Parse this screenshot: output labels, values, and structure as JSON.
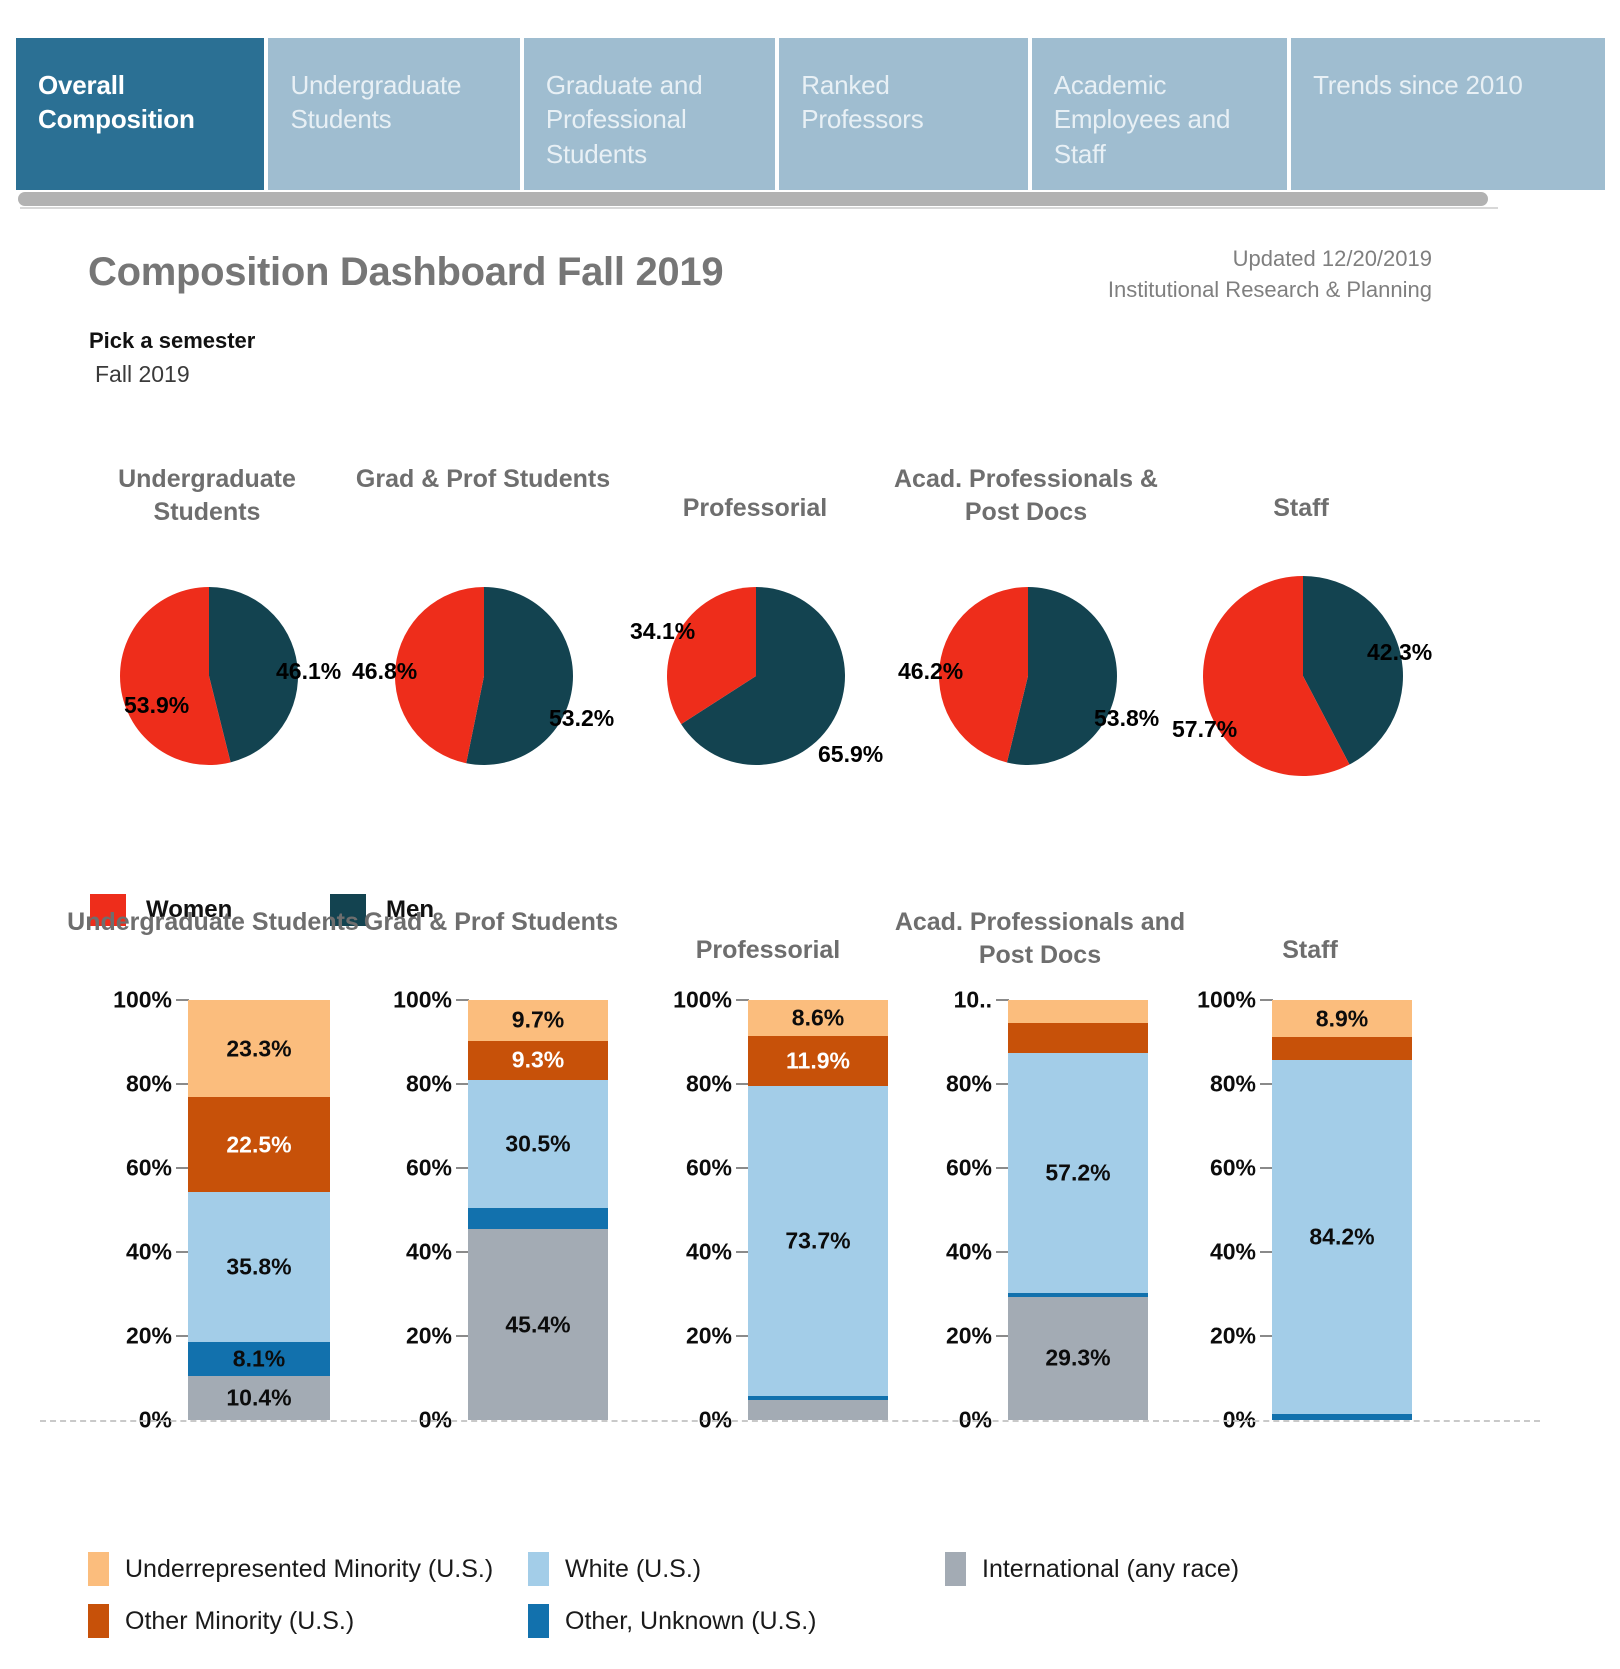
{
  "tabs": [
    {
      "label": "Overall Composition",
      "active": true
    },
    {
      "label": "Undergraduate Students",
      "active": false
    },
    {
      "label": "Graduate and Professional Students",
      "active": false
    },
    {
      "label": "Ranked Professors",
      "active": false
    },
    {
      "label": "Academic Employees and Staff",
      "active": false
    },
    {
      "label": "Trends since 2010",
      "active": false
    }
  ],
  "header": {
    "title": "Composition Dashboard  Fall 2019",
    "updated": "Updated 12/20/2019",
    "org": "Institutional Research & Planning",
    "pick_label": "Pick a semester",
    "pick_value": "Fall 2019"
  },
  "colors": {
    "tab_active_bg": "#2b7094",
    "tab_inactive_bg": "#9fbdd0",
    "women": "#ee2d1b",
    "men": "#134350",
    "underrep_minority": "#fbbd7d",
    "other_minority": "#c75109",
    "white": "#a3cde8",
    "other_unknown": "#1271ad",
    "international": "#a3abb4",
    "title_gray": "#6e6e6e"
  },
  "gender_legend": [
    {
      "label": "Women",
      "color": "#ee2d1b"
    },
    {
      "label": "Men",
      "color": "#134350"
    }
  ],
  "race_legend": [
    {
      "label": "Underrepresented Minority (U.S.)",
      "color": "#fbbd7d"
    },
    {
      "label": "Other Minority (U.S.)",
      "color": "#c75109"
    },
    {
      "label": "White (U.S.)",
      "color": "#a3cde8"
    },
    {
      "label": "Other, Unknown (U.S.)",
      "color": "#1271ad"
    },
    {
      "label": "International (any race)",
      "color": "#a3abb4"
    }
  ],
  "chart_data": [
    {
      "type": "pie",
      "title": "Undergraduate Students",
      "slices": [
        {
          "name": "Women",
          "value": 53.9,
          "label": "53.9%",
          "color": "#ee2d1b"
        },
        {
          "name": "Men",
          "value": 46.1,
          "label": "46.1%",
          "color": "#134350"
        }
      ]
    },
    {
      "type": "pie",
      "title": "Grad & Prof Students",
      "slices": [
        {
          "name": "Women",
          "value": 46.8,
          "label": "46.8%",
          "color": "#ee2d1b"
        },
        {
          "name": "Men",
          "value": 53.2,
          "label": "53.2%",
          "color": "#134350"
        }
      ]
    },
    {
      "type": "pie",
      "title": "Professorial",
      "slices": [
        {
          "name": "Women",
          "value": 34.1,
          "label": "34.1%",
          "color": "#ee2d1b"
        },
        {
          "name": "Men",
          "value": 65.9,
          "label": "65.9%",
          "color": "#134350"
        }
      ]
    },
    {
      "type": "pie",
      "title": "Acad. Professionals & Post Docs",
      "slices": [
        {
          "name": "Women",
          "value": 46.2,
          "label": "46.2%",
          "color": "#ee2d1b"
        },
        {
          "name": "Men",
          "value": 53.8,
          "label": "53.8%",
          "color": "#134350"
        }
      ]
    },
    {
      "type": "pie",
      "title": "Staff",
      "slices": [
        {
          "name": "Women",
          "value": 57.7,
          "label": "57.7%",
          "color": "#ee2d1b"
        },
        {
          "name": "Men",
          "value": 42.3,
          "label": "42.3%",
          "color": "#134350"
        }
      ]
    },
    {
      "type": "bar",
      "subtype": "stacked-100",
      "title": "Undergraduate Students",
      "ylabel": "",
      "ylim": [
        0,
        100
      ],
      "yticks": [
        "0%",
        "20%",
        "40%",
        "60%",
        "80%",
        "100%"
      ],
      "categories": [
        "International (any race)",
        "Other, Unknown (U.S.)",
        "White (U.S.)",
        "Other Minority (U.S.)",
        "Underrepresented Minority (U.S.)"
      ],
      "values": [
        10.4,
        8.1,
        35.8,
        22.5,
        23.3
      ],
      "labels": [
        "10.4%",
        "8.1%",
        "35.8%",
        "22.5%",
        "23.3%"
      ]
    },
    {
      "type": "bar",
      "subtype": "stacked-100",
      "title": "Grad & Prof Students",
      "ylim": [
        0,
        100
      ],
      "yticks": [
        "0%",
        "20%",
        "40%",
        "60%",
        "80%",
        "100%"
      ],
      "categories": [
        "International (any race)",
        "Other, Unknown (U.S.)",
        "White (U.S.)",
        "Other Minority (U.S.)",
        "Underrepresented Minority (U.S.)"
      ],
      "values": [
        45.4,
        5.1,
        30.5,
        9.3,
        9.7
      ],
      "labels": [
        "45.4%",
        "",
        "30.5%",
        "9.3%",
        "9.7%"
      ]
    },
    {
      "type": "bar",
      "subtype": "stacked-100",
      "title": "Professorial",
      "ylim": [
        0,
        100
      ],
      "yticks": [
        "0%",
        "20%",
        "40%",
        "60%",
        "80%",
        "100%"
      ],
      "categories": [
        "International (any race)",
        "Other, Unknown (U.S.)",
        "White (U.S.)",
        "Other Minority (U.S.)",
        "Underrepresented Minority (U.S.)"
      ],
      "values": [
        4.7,
        1.1,
        73.7,
        11.9,
        8.6
      ],
      "labels": [
        "",
        "",
        "73.7%",
        "11.9%",
        "8.6%"
      ]
    },
    {
      "type": "bar",
      "subtype": "stacked-100",
      "title": "Acad. Professionals and Post Docs",
      "ylim": [
        0,
        100
      ],
      "yticks": [
        "0%",
        "20%",
        "40%",
        "60%",
        "80%",
        "10.."
      ],
      "categories": [
        "International (any race)",
        "Other, Unknown (U.S.)",
        "White (U.S.)",
        "Other Minority (U.S.)",
        "Underrepresented Minority (U.S.)"
      ],
      "values": [
        29.3,
        1.0,
        57.2,
        7.0,
        5.5
      ],
      "labels": [
        "29.3%",
        "",
        "57.2%",
        "",
        ""
      ]
    },
    {
      "type": "bar",
      "subtype": "stacked-100",
      "title": "Staff",
      "ylim": [
        0,
        100
      ],
      "yticks": [
        "0%",
        "20%",
        "40%",
        "60%",
        "80%",
        "100%"
      ],
      "categories": [
        "International (any race)",
        "Other, Unknown (U.S.)",
        "White (U.S.)",
        "Other Minority (U.S.)",
        "Underrepresented Minority (U.S.)"
      ],
      "values": [
        0.0,
        1.5,
        84.2,
        5.4,
        8.9
      ],
      "labels": [
        "",
        "",
        "84.2%",
        "",
        "8.9%"
      ]
    }
  ]
}
